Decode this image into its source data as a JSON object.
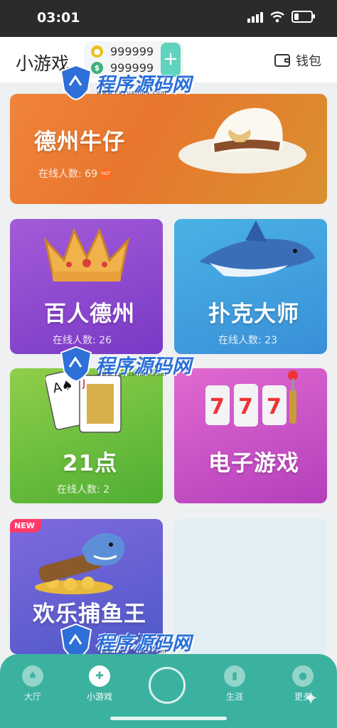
{
  "status_bar": {
    "time": "03:01"
  },
  "header": {
    "title": "小游戏",
    "gold_balance": "999999",
    "cash_balance": "999999",
    "add_label": "+",
    "wallet_label": "钱包"
  },
  "games": [
    {
      "title": "德州牛仔",
      "online": "在线人数: 69",
      "hot": "HOT"
    },
    {
      "title": "百人德州",
      "online": "在线人数: 26"
    },
    {
      "title": "扑克大师",
      "online": "在线人数: 23"
    },
    {
      "title": "21点",
      "online": "在线人数: 2"
    },
    {
      "title": "电子游戏"
    },
    {
      "title": "欢乐捕鱼王",
      "badge": "NEW"
    }
  ],
  "watermark": {
    "text": "程序源码网",
    "url": "www.cxyuanma.com"
  },
  "nav": {
    "items": [
      {
        "label": "大厅",
        "icon": "spade-icon"
      },
      {
        "label": "小游戏",
        "icon": "gamepad-icon"
      },
      {
        "label": "生涯",
        "icon": "bar-chart-icon"
      },
      {
        "label": "更多",
        "icon": "user-icon"
      }
    ]
  },
  "colors": {
    "accent": "#3bb29f",
    "texas": "#e8762e",
    "baiyuan": "#8f4bd0",
    "poker": "#4aa6e0",
    "blackjack": "#6dbd3d",
    "slots": "#c850c4",
    "fish": "#6b60d6"
  }
}
